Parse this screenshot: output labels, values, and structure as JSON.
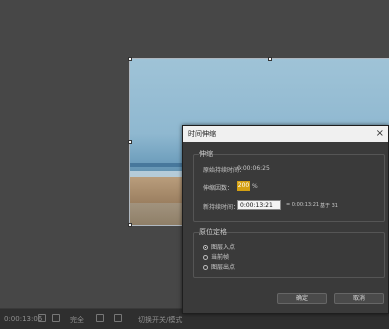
{
  "dialog": {
    "title": "时间伸缩",
    "stretch_group": {
      "title": "伸缩",
      "original_duration_label": "原始持续时间：",
      "original_duration_value": "0:00:06:25",
      "stretch_factor_label": "伸缩因数：",
      "stretch_factor_value": "200",
      "stretch_factor_unit": "%",
      "new_duration_label": "新持续时间：",
      "new_duration_value": "0:00:13:21",
      "new_duration_note": "= 0:00:13:21",
      "base_label": "基于 31"
    },
    "hold_group": {
      "title": "原位定格",
      "options": [
        {
          "label": "图层入点",
          "selected": true
        },
        {
          "label": "当前帧",
          "selected": false
        },
        {
          "label": "图层出点",
          "selected": false
        }
      ]
    },
    "ok_label": "确定",
    "cancel_label": "取消"
  },
  "bottom_bar": {
    "timecode": "0:00:13:06",
    "zoom": "完全",
    "toggle_label": "切换开关/模式"
  }
}
